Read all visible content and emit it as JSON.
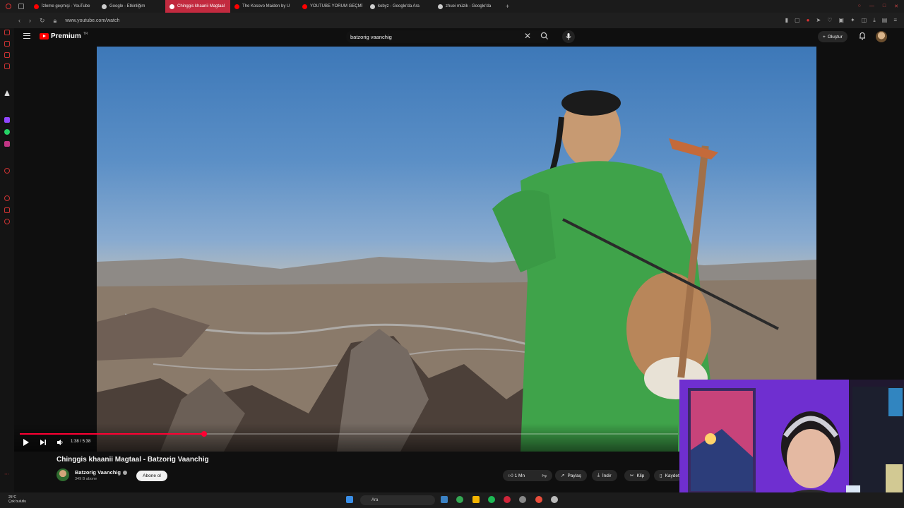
{
  "browser": {
    "tabs": [
      {
        "label": "İzleme geçmişi - YouTube",
        "active": false,
        "favicon_color": "#ff0000"
      },
      {
        "label": "Google - Etkinliğim",
        "active": false,
        "favicon_color": "#cccccc"
      },
      {
        "label": "Chinggis khaanii Magtaal",
        "active": true,
        "favicon_color": "#ff0000"
      },
      {
        "label": "The Kosovo Maiden by U",
        "active": false,
        "favicon_color": "#ff0000"
      },
      {
        "label": "YOUTUBE YORUM GEÇMİ",
        "active": false,
        "favicon_color": "#ff0000"
      },
      {
        "label": "kobyz - Google'da Ara",
        "active": false,
        "favicon_color": "#cccccc"
      },
      {
        "label": "zhuei müzik - Google'da",
        "active": false,
        "favicon_color": "#cccccc"
      }
    ],
    "new_tab": "+",
    "url": "www.youtube.com/watch"
  },
  "youtube": {
    "logo_text": "Premium",
    "logo_sup": "TR",
    "search_value": "batzorig vaanchig",
    "create_label": "Oluştur"
  },
  "player": {
    "time": "1:38 / 5:38",
    "progress": 0.28
  },
  "video_info": {
    "title": "Chinggis khaanii Magtaal - Batzorig Vaanchig",
    "channel": "Batzorig Vaanchig",
    "subscribers": "349 B abone",
    "subscribe_label": "Abone ol",
    "likes": "1 Mn",
    "share_label": "Paylaş",
    "download_label": "İndir",
    "clip_label": "Klip",
    "save_label": "Kaydet"
  },
  "taskbar": {
    "weather_temp": "25°C",
    "weather_desc": "Çok bulutlu",
    "search_label": "Ara"
  },
  "colors": {
    "accent": "#ff0033",
    "active_tab": "#c22a3f",
    "background": "#0f0f0f"
  }
}
